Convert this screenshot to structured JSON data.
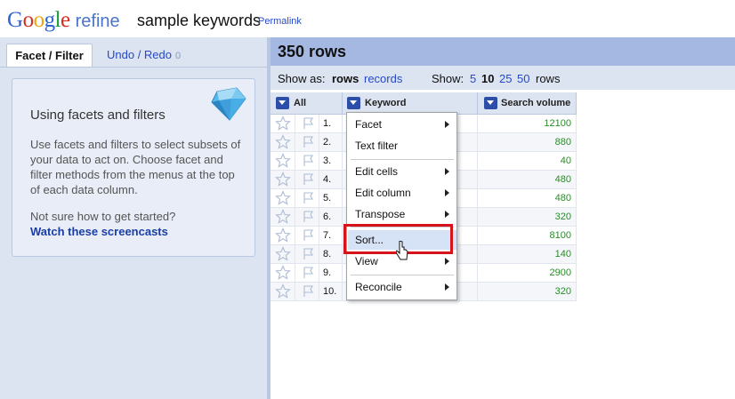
{
  "header": {
    "logo_google": "Google",
    "logo_refine": "refine",
    "project_title": "sample keywords",
    "permalink": "Permalink"
  },
  "left_panel": {
    "tab_facet": "Facet / Filter",
    "tab_undo": "Undo / Redo",
    "tab_undo_count": "0",
    "help_title": "Using facets and filters",
    "help_body": "Use facets and filters to select subsets of your data to act on. Choose facet and filter methods from the menus at the top of each data column.",
    "help_question": "Not sure how to get started?",
    "help_link": "Watch these screencasts"
  },
  "right_panel": {
    "rows_count": "350 rows",
    "show_as_label": "Show as:",
    "show_rows": "rows",
    "show_records": "records",
    "show_label": "Show:",
    "page_sizes": [
      "5",
      "10",
      "25",
      "50"
    ],
    "page_size_selected": "10",
    "rows_suffix": "rows"
  },
  "grid": {
    "columns": [
      "All",
      "Keyword",
      "Search volume"
    ],
    "rows": [
      {
        "idx": "1.",
        "keyword": "",
        "volume": "12100"
      },
      {
        "idx": "2.",
        "keyword": "tel",
        "volume": "880"
      },
      {
        "idx": "3.",
        "keyword": "",
        "volume": "40"
      },
      {
        "idx": "4.",
        "keyword": "s",
        "volume": "480"
      },
      {
        "idx": "5.",
        "keyword": "s",
        "volume": "480"
      },
      {
        "idx": "6.",
        "keyword": "",
        "volume": "320"
      },
      {
        "idx": "7.",
        "keyword": "",
        "volume": "8100"
      },
      {
        "idx": "8.",
        "keyword": "",
        "volume": "140"
      },
      {
        "idx": "9.",
        "keyword": "",
        "volume": "2900"
      },
      {
        "idx": "10.",
        "keyword": "ées",
        "volume": "320"
      }
    ]
  },
  "menu": {
    "facet": "Facet",
    "text_filter": "Text filter",
    "edit_cells": "Edit cells",
    "edit_column": "Edit column",
    "transpose": "Transpose",
    "sort": "Sort...",
    "view": "View",
    "reconcile": "Reconcile"
  },
  "colors": {
    "accent_blue": "#2c4ea8",
    "highlight_red": "#d6131a",
    "volume_green": "#2b8a2b"
  }
}
